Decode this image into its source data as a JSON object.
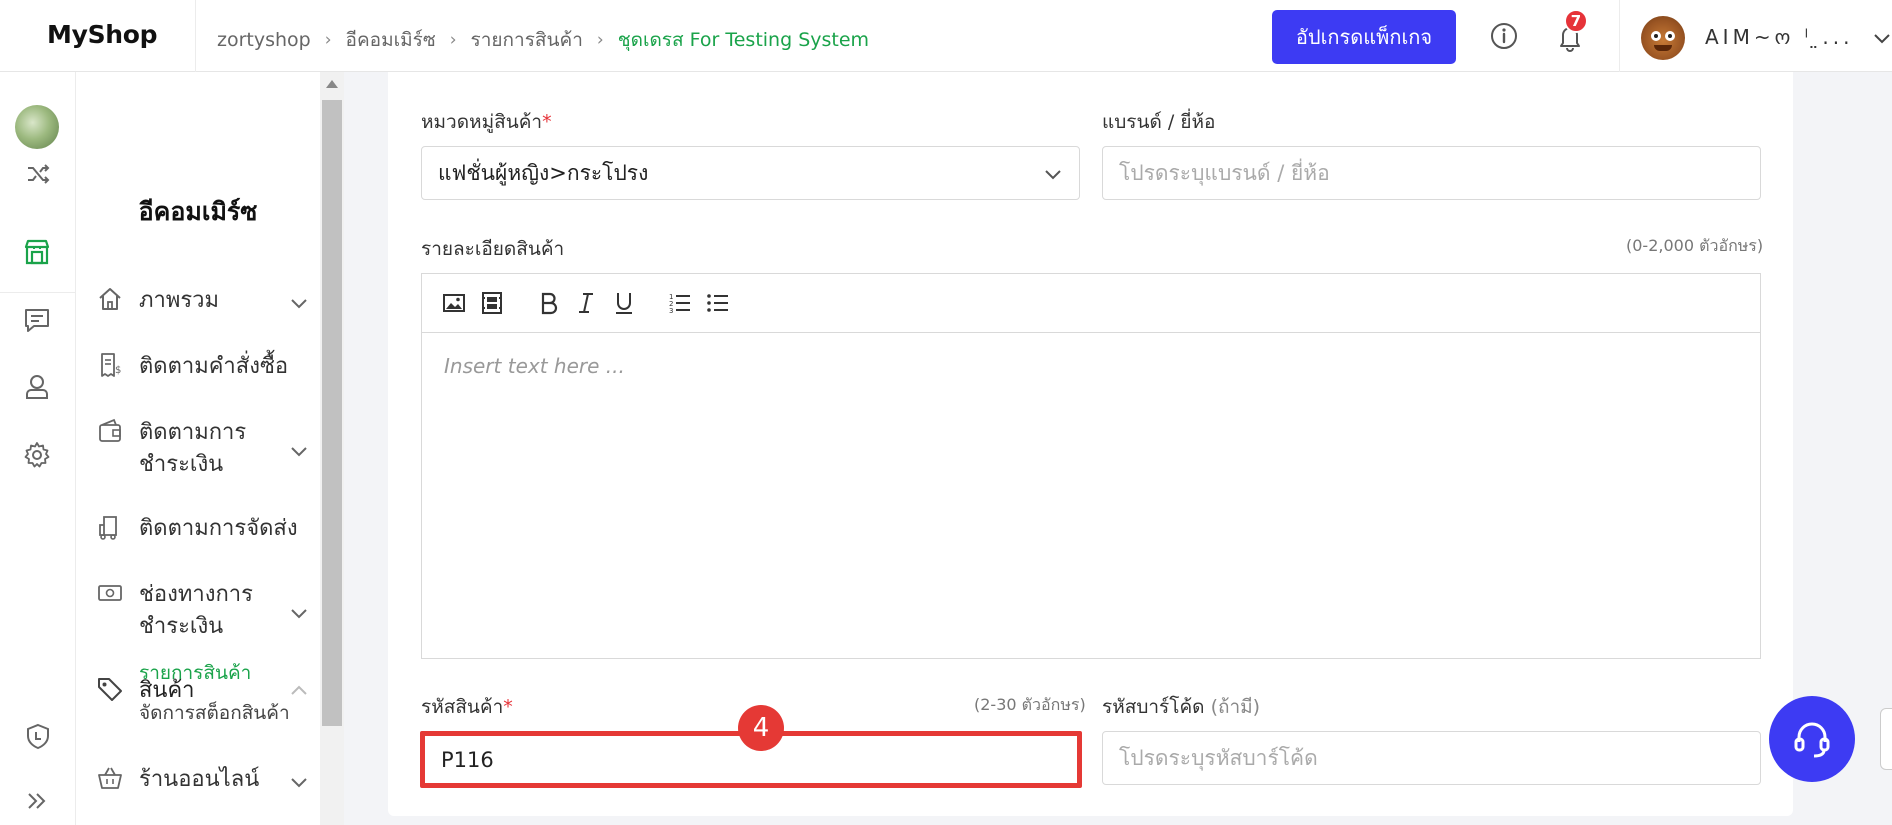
{
  "app": {
    "logo": "MyShop"
  },
  "breadcrumb": {
    "items": [
      "zortyshop",
      "อีคอมเมิร์ซ",
      "รายการสินค้า"
    ],
    "current": "ชุดเดรส For Testing System"
  },
  "header": {
    "upgrade_label": "อัปเกรดแพ็กเกจ",
    "notification_count": "7",
    "username": "AIM~ო ˡ ̤..."
  },
  "sidebar": {
    "title": "อีคอมเมิร์ซ",
    "items": [
      {
        "label": "ภาพรวม",
        "icon": "home-icon",
        "expandable": true
      },
      {
        "label": "ติดตามคำสั่งซื้อ",
        "icon": "receipt-icon",
        "expandable": false
      },
      {
        "label": "ติดตามการชำระเงิน",
        "icon": "wallet-icon",
        "expandable": true
      },
      {
        "label": "ติดตามการจัดส่ง",
        "icon": "truck-icon",
        "expandable": false
      },
      {
        "label": "ช่องทางการชำระเงิน",
        "icon": "money-icon",
        "expandable": true
      },
      {
        "label": "สินค้า",
        "icon": "tag-icon",
        "expandable": true,
        "expanded": true
      },
      {
        "label": "ร้านออนไลน์",
        "icon": "basket-icon",
        "expandable": true
      }
    ],
    "subitems": [
      "รายการสินค้า",
      "จัดการสต็อกสินค้า"
    ]
  },
  "form": {
    "category": {
      "label": "หมวดหมู่สินค้า",
      "required": "*",
      "value": "แฟชั่นผู้หญิง>กระโปรง"
    },
    "brand": {
      "label": "แบรนด์ / ยี่ห้อ",
      "placeholder": "โปรดระบุแบรนด์ / ยี่ห้อ"
    },
    "description": {
      "label": "รายละเอียดสินค้า",
      "hint": "(0-2,000 ตัวอักษร)",
      "placeholder": "Insert text here ..."
    },
    "sku": {
      "label": "รหัสสินค้า",
      "required": "*",
      "hint": "(2-30 ตัวอักษร)",
      "value": "P116"
    },
    "barcode": {
      "label": "รหัสบาร์โค้ด",
      "optional": "(ถ้ามี)",
      "placeholder": "โปรดระบุรหัสบาร์โค้ด"
    }
  },
  "annotation": {
    "step": "4"
  },
  "colors": {
    "accent": "#3d3bf3",
    "active_green": "#1aa34a",
    "highlight_red": "#e53935"
  }
}
